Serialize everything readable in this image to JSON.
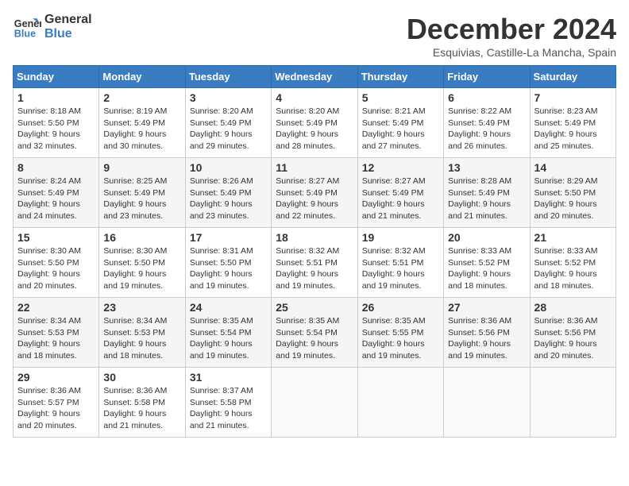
{
  "header": {
    "logo_line1": "General",
    "logo_line2": "Blue",
    "month_title": "December 2024",
    "subtitle": "Esquivias, Castille-La Mancha, Spain"
  },
  "weekdays": [
    "Sunday",
    "Monday",
    "Tuesday",
    "Wednesday",
    "Thursday",
    "Friday",
    "Saturday"
  ],
  "weeks": [
    [
      {
        "day": "1",
        "sunrise": "Sunrise: 8:18 AM",
        "sunset": "Sunset: 5:50 PM",
        "daylight": "Daylight: 9 hours and 32 minutes."
      },
      {
        "day": "2",
        "sunrise": "Sunrise: 8:19 AM",
        "sunset": "Sunset: 5:49 PM",
        "daylight": "Daylight: 9 hours and 30 minutes."
      },
      {
        "day": "3",
        "sunrise": "Sunrise: 8:20 AM",
        "sunset": "Sunset: 5:49 PM",
        "daylight": "Daylight: 9 hours and 29 minutes."
      },
      {
        "day": "4",
        "sunrise": "Sunrise: 8:20 AM",
        "sunset": "Sunset: 5:49 PM",
        "daylight": "Daylight: 9 hours and 28 minutes."
      },
      {
        "day": "5",
        "sunrise": "Sunrise: 8:21 AM",
        "sunset": "Sunset: 5:49 PM",
        "daylight": "Daylight: 9 hours and 27 minutes."
      },
      {
        "day": "6",
        "sunrise": "Sunrise: 8:22 AM",
        "sunset": "Sunset: 5:49 PM",
        "daylight": "Daylight: 9 hours and 26 minutes."
      },
      {
        "day": "7",
        "sunrise": "Sunrise: 8:23 AM",
        "sunset": "Sunset: 5:49 PM",
        "daylight": "Daylight: 9 hours and 25 minutes."
      }
    ],
    [
      {
        "day": "8",
        "sunrise": "Sunrise: 8:24 AM",
        "sunset": "Sunset: 5:49 PM",
        "daylight": "Daylight: 9 hours and 24 minutes."
      },
      {
        "day": "9",
        "sunrise": "Sunrise: 8:25 AM",
        "sunset": "Sunset: 5:49 PM",
        "daylight": "Daylight: 9 hours and 23 minutes."
      },
      {
        "day": "10",
        "sunrise": "Sunrise: 8:26 AM",
        "sunset": "Sunset: 5:49 PM",
        "daylight": "Daylight: 9 hours and 23 minutes."
      },
      {
        "day": "11",
        "sunrise": "Sunrise: 8:27 AM",
        "sunset": "Sunset: 5:49 PM",
        "daylight": "Daylight: 9 hours and 22 minutes."
      },
      {
        "day": "12",
        "sunrise": "Sunrise: 8:27 AM",
        "sunset": "Sunset: 5:49 PM",
        "daylight": "Daylight: 9 hours and 21 minutes."
      },
      {
        "day": "13",
        "sunrise": "Sunrise: 8:28 AM",
        "sunset": "Sunset: 5:49 PM",
        "daylight": "Daylight: 9 hours and 21 minutes."
      },
      {
        "day": "14",
        "sunrise": "Sunrise: 8:29 AM",
        "sunset": "Sunset: 5:50 PM",
        "daylight": "Daylight: 9 hours and 20 minutes."
      }
    ],
    [
      {
        "day": "15",
        "sunrise": "Sunrise: 8:30 AM",
        "sunset": "Sunset: 5:50 PM",
        "daylight": "Daylight: 9 hours and 20 minutes."
      },
      {
        "day": "16",
        "sunrise": "Sunrise: 8:30 AM",
        "sunset": "Sunset: 5:50 PM",
        "daylight": "Daylight: 9 hours and 19 minutes."
      },
      {
        "day": "17",
        "sunrise": "Sunrise: 8:31 AM",
        "sunset": "Sunset: 5:50 PM",
        "daylight": "Daylight: 9 hours and 19 minutes."
      },
      {
        "day": "18",
        "sunrise": "Sunrise: 8:32 AM",
        "sunset": "Sunset: 5:51 PM",
        "daylight": "Daylight: 9 hours and 19 minutes."
      },
      {
        "day": "19",
        "sunrise": "Sunrise: 8:32 AM",
        "sunset": "Sunset: 5:51 PM",
        "daylight": "Daylight: 9 hours and 19 minutes."
      },
      {
        "day": "20",
        "sunrise": "Sunrise: 8:33 AM",
        "sunset": "Sunset: 5:52 PM",
        "daylight": "Daylight: 9 hours and 18 minutes."
      },
      {
        "day": "21",
        "sunrise": "Sunrise: 8:33 AM",
        "sunset": "Sunset: 5:52 PM",
        "daylight": "Daylight: 9 hours and 18 minutes."
      }
    ],
    [
      {
        "day": "22",
        "sunrise": "Sunrise: 8:34 AM",
        "sunset": "Sunset: 5:53 PM",
        "daylight": "Daylight: 9 hours and 18 minutes."
      },
      {
        "day": "23",
        "sunrise": "Sunrise: 8:34 AM",
        "sunset": "Sunset: 5:53 PM",
        "daylight": "Daylight: 9 hours and 18 minutes."
      },
      {
        "day": "24",
        "sunrise": "Sunrise: 8:35 AM",
        "sunset": "Sunset: 5:54 PM",
        "daylight": "Daylight: 9 hours and 19 minutes."
      },
      {
        "day": "25",
        "sunrise": "Sunrise: 8:35 AM",
        "sunset": "Sunset: 5:54 PM",
        "daylight": "Daylight: 9 hours and 19 minutes."
      },
      {
        "day": "26",
        "sunrise": "Sunrise: 8:35 AM",
        "sunset": "Sunset: 5:55 PM",
        "daylight": "Daylight: 9 hours and 19 minutes."
      },
      {
        "day": "27",
        "sunrise": "Sunrise: 8:36 AM",
        "sunset": "Sunset: 5:56 PM",
        "daylight": "Daylight: 9 hours and 19 minutes."
      },
      {
        "day": "28",
        "sunrise": "Sunrise: 8:36 AM",
        "sunset": "Sunset: 5:56 PM",
        "daylight": "Daylight: 9 hours and 20 minutes."
      }
    ],
    [
      {
        "day": "29",
        "sunrise": "Sunrise: 8:36 AM",
        "sunset": "Sunset: 5:57 PM",
        "daylight": "Daylight: 9 hours and 20 minutes."
      },
      {
        "day": "30",
        "sunrise": "Sunrise: 8:36 AM",
        "sunset": "Sunset: 5:58 PM",
        "daylight": "Daylight: 9 hours and 21 minutes."
      },
      {
        "day": "31",
        "sunrise": "Sunrise: 8:37 AM",
        "sunset": "Sunset: 5:58 PM",
        "daylight": "Daylight: 9 hours and 21 minutes."
      },
      null,
      null,
      null,
      null
    ]
  ]
}
